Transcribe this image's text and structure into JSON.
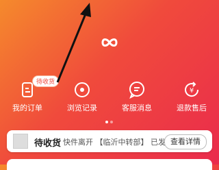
{
  "header": {
    "logo_icon": "infinity-icon"
  },
  "quick_actions": [
    {
      "label": "我的订单",
      "icon": "order-doc-icon",
      "badge": "待收货"
    },
    {
      "label": "浏览记录",
      "icon": "eye-icon"
    },
    {
      "label": "客服消息",
      "icon": "chat-bubble-icon"
    },
    {
      "label": "退款售后",
      "icon": "refund-yen-icon"
    }
  ],
  "pagination": {
    "pages": 2,
    "current": 1
  },
  "order_card": {
    "status": "待收货",
    "description": "快件离开 【临沂中转部】 已发...",
    "detail_button": "查看详情"
  },
  "annotation": {
    "type": "arrow",
    "color": "#111111"
  }
}
